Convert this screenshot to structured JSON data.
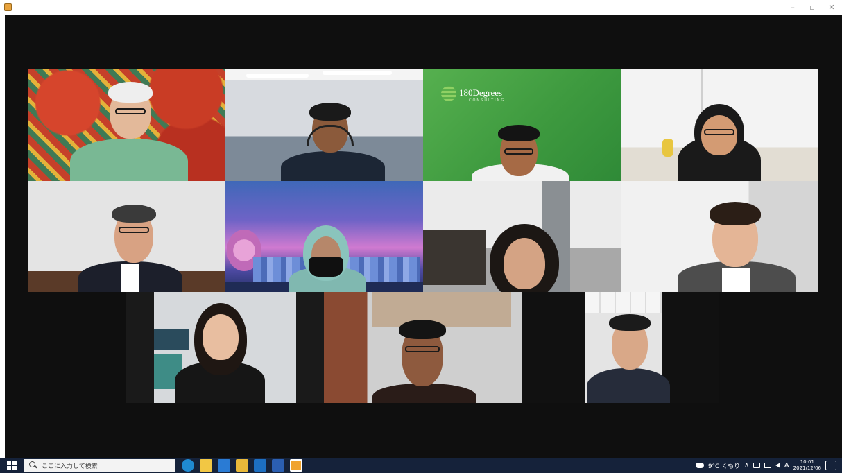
{
  "window": {
    "minimize_icon": "minimize-icon",
    "maximize_icon": "maximize-icon",
    "close_icon": "close-icon",
    "minimize_glyph": "–",
    "maximize_glyph": "▫",
    "close_glyph": "✕"
  },
  "meeting": {
    "participant_count": 11,
    "tiles": [
      {
        "id": "p1"
      },
      {
        "id": "p2"
      },
      {
        "id": "p3"
      },
      {
        "id": "p4"
      },
      {
        "id": "p5"
      },
      {
        "id": "p6"
      },
      {
        "id": "p7"
      },
      {
        "id": "p8"
      },
      {
        "id": "p9"
      },
      {
        "id": "p10"
      },
      {
        "id": "p11"
      }
    ],
    "virtual_background_logo": "180Degrees",
    "virtual_background_sub": "CONSULTING"
  },
  "taskbar": {
    "search_placeholder": "ここに入力して検索",
    "apps": [
      {
        "name": "edge-icon",
        "color": "#1f8ad2"
      },
      {
        "name": "file-explorer-icon",
        "color": "#f2c744"
      },
      {
        "name": "mail-icon",
        "color": "#2a7bd4"
      },
      {
        "name": "folder-icon",
        "color": "#e9b93a"
      },
      {
        "name": "outlook-icon",
        "color": "#1d6fc2"
      },
      {
        "name": "word-icon",
        "color": "#2b5fb2"
      },
      {
        "name": "zoom-icon",
        "color": "#f0a32f"
      }
    ],
    "weather": "9°C くもり",
    "tray_up": "∧",
    "ime": "A",
    "time": "10:01",
    "date": "2021/12/06"
  },
  "colors": {
    "stage": "#0f0f0f",
    "taskbar": "#15223a",
    "accent_green": "#3fa148"
  }
}
